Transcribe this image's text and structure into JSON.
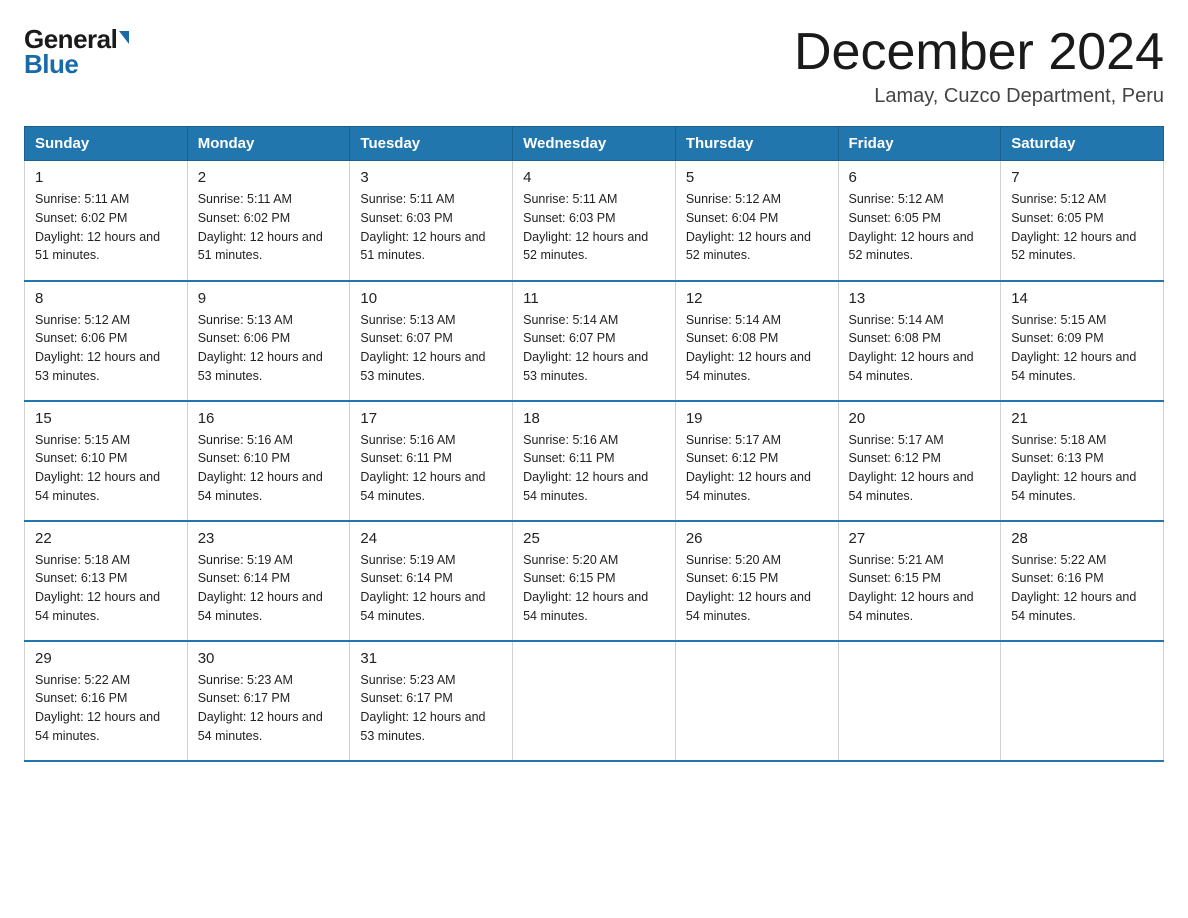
{
  "logo": {
    "general": "General",
    "blue": "Blue"
  },
  "title": {
    "month": "December 2024",
    "location": "Lamay, Cuzco Department, Peru"
  },
  "headers": [
    "Sunday",
    "Monday",
    "Tuesday",
    "Wednesday",
    "Thursday",
    "Friday",
    "Saturday"
  ],
  "weeks": [
    [
      {
        "day": "1",
        "sunrise": "5:11 AM",
        "sunset": "6:02 PM",
        "daylight": "12 hours and 51 minutes."
      },
      {
        "day": "2",
        "sunrise": "5:11 AM",
        "sunset": "6:02 PM",
        "daylight": "12 hours and 51 minutes."
      },
      {
        "day": "3",
        "sunrise": "5:11 AM",
        "sunset": "6:03 PM",
        "daylight": "12 hours and 51 minutes."
      },
      {
        "day": "4",
        "sunrise": "5:11 AM",
        "sunset": "6:03 PM",
        "daylight": "12 hours and 52 minutes."
      },
      {
        "day": "5",
        "sunrise": "5:12 AM",
        "sunset": "6:04 PM",
        "daylight": "12 hours and 52 minutes."
      },
      {
        "day": "6",
        "sunrise": "5:12 AM",
        "sunset": "6:05 PM",
        "daylight": "12 hours and 52 minutes."
      },
      {
        "day": "7",
        "sunrise": "5:12 AM",
        "sunset": "6:05 PM",
        "daylight": "12 hours and 52 minutes."
      }
    ],
    [
      {
        "day": "8",
        "sunrise": "5:12 AM",
        "sunset": "6:06 PM",
        "daylight": "12 hours and 53 minutes."
      },
      {
        "day": "9",
        "sunrise": "5:13 AM",
        "sunset": "6:06 PM",
        "daylight": "12 hours and 53 minutes."
      },
      {
        "day": "10",
        "sunrise": "5:13 AM",
        "sunset": "6:07 PM",
        "daylight": "12 hours and 53 minutes."
      },
      {
        "day": "11",
        "sunrise": "5:14 AM",
        "sunset": "6:07 PM",
        "daylight": "12 hours and 53 minutes."
      },
      {
        "day": "12",
        "sunrise": "5:14 AM",
        "sunset": "6:08 PM",
        "daylight": "12 hours and 54 minutes."
      },
      {
        "day": "13",
        "sunrise": "5:14 AM",
        "sunset": "6:08 PM",
        "daylight": "12 hours and 54 minutes."
      },
      {
        "day": "14",
        "sunrise": "5:15 AM",
        "sunset": "6:09 PM",
        "daylight": "12 hours and 54 minutes."
      }
    ],
    [
      {
        "day": "15",
        "sunrise": "5:15 AM",
        "sunset": "6:10 PM",
        "daylight": "12 hours and 54 minutes."
      },
      {
        "day": "16",
        "sunrise": "5:16 AM",
        "sunset": "6:10 PM",
        "daylight": "12 hours and 54 minutes."
      },
      {
        "day": "17",
        "sunrise": "5:16 AM",
        "sunset": "6:11 PM",
        "daylight": "12 hours and 54 minutes."
      },
      {
        "day": "18",
        "sunrise": "5:16 AM",
        "sunset": "6:11 PM",
        "daylight": "12 hours and 54 minutes."
      },
      {
        "day": "19",
        "sunrise": "5:17 AM",
        "sunset": "6:12 PM",
        "daylight": "12 hours and 54 minutes."
      },
      {
        "day": "20",
        "sunrise": "5:17 AM",
        "sunset": "6:12 PM",
        "daylight": "12 hours and 54 minutes."
      },
      {
        "day": "21",
        "sunrise": "5:18 AM",
        "sunset": "6:13 PM",
        "daylight": "12 hours and 54 minutes."
      }
    ],
    [
      {
        "day": "22",
        "sunrise": "5:18 AM",
        "sunset": "6:13 PM",
        "daylight": "12 hours and 54 minutes."
      },
      {
        "day": "23",
        "sunrise": "5:19 AM",
        "sunset": "6:14 PM",
        "daylight": "12 hours and 54 minutes."
      },
      {
        "day": "24",
        "sunrise": "5:19 AM",
        "sunset": "6:14 PM",
        "daylight": "12 hours and 54 minutes."
      },
      {
        "day": "25",
        "sunrise": "5:20 AM",
        "sunset": "6:15 PM",
        "daylight": "12 hours and 54 minutes."
      },
      {
        "day": "26",
        "sunrise": "5:20 AM",
        "sunset": "6:15 PM",
        "daylight": "12 hours and 54 minutes."
      },
      {
        "day": "27",
        "sunrise": "5:21 AM",
        "sunset": "6:15 PM",
        "daylight": "12 hours and 54 minutes."
      },
      {
        "day": "28",
        "sunrise": "5:22 AM",
        "sunset": "6:16 PM",
        "daylight": "12 hours and 54 minutes."
      }
    ],
    [
      {
        "day": "29",
        "sunrise": "5:22 AM",
        "sunset": "6:16 PM",
        "daylight": "12 hours and 54 minutes."
      },
      {
        "day": "30",
        "sunrise": "5:23 AM",
        "sunset": "6:17 PM",
        "daylight": "12 hours and 54 minutes."
      },
      {
        "day": "31",
        "sunrise": "5:23 AM",
        "sunset": "6:17 PM",
        "daylight": "12 hours and 53 minutes."
      },
      null,
      null,
      null,
      null
    ]
  ]
}
